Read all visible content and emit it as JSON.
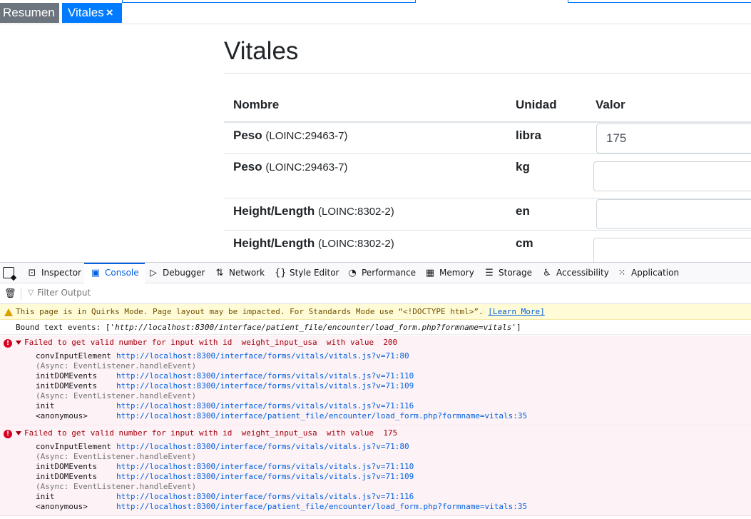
{
  "tabs": [
    {
      "label": "Resumen"
    },
    {
      "label": "Vitales",
      "close": "×"
    }
  ],
  "form": {
    "title": "Vitales",
    "headers": {
      "name": "Nombre",
      "unit": "Unidad",
      "value": "Valor"
    },
    "rows": [
      {
        "name": "Peso",
        "code": "(LOINC:29463-7)",
        "unit": "libra",
        "value": "175"
      },
      {
        "name": "Peso",
        "code": "(LOINC:29463-7)",
        "unit": "kg",
        "value": ""
      },
      {
        "name": "Height/Length",
        "code": "(LOINC:8302-2)",
        "unit": "en",
        "value": ""
      },
      {
        "name": "Height/Length",
        "code": "(LOINC:8302-2)",
        "unit": "cm",
        "value": ""
      }
    ]
  },
  "devtools": {
    "tabs": [
      {
        "label": "Inspector",
        "icon": "inspector-icon"
      },
      {
        "label": "Console",
        "icon": "console-icon",
        "active": true
      },
      {
        "label": "Debugger",
        "icon": "debugger-icon"
      },
      {
        "label": "Network",
        "icon": "network-icon"
      },
      {
        "label": "Style Editor",
        "icon": "style-editor-icon"
      },
      {
        "label": "Performance",
        "icon": "performance-icon"
      },
      {
        "label": "Memory",
        "icon": "memory-icon"
      },
      {
        "label": "Storage",
        "icon": "storage-icon"
      },
      {
        "label": "Accessibility",
        "icon": "accessibility-icon"
      },
      {
        "label": "Application",
        "icon": "application-icon"
      }
    ],
    "filter_placeholder": "Filter Output",
    "colors": {
      "accent": "#0061e0",
      "error": "#a4000f",
      "error_bg": "#fdf2f5",
      "warning_bg": "#fffbd6"
    },
    "warning": {
      "text": "This page is in Quirks Mode. Page layout may be impacted. For Standards Mode use “<!DOCTYPE html>”.",
      "link": "[Learn More]"
    },
    "log": {
      "prefix": "Bound text events: ['",
      "url": "http://localhost:8300/interface/patient_file/encounter/load_form.php?formname=vitals",
      "suffix": "']"
    },
    "errors": [
      {
        "message": "Failed to get valid number for input with id  weight_input_usa  with value  200",
        "frames": [
          {
            "fn": "convInputElement",
            "url": "http://localhost:8300/interface/forms/vitals/vitals.js?v=71:80"
          },
          {
            "async": "(Async: EventListener.handleEvent)"
          },
          {
            "fn": "initDOMEvents",
            "url": "http://localhost:8300/interface/forms/vitals/vitals.js?v=71:110"
          },
          {
            "fn": "initDOMEvents",
            "url": "http://localhost:8300/interface/forms/vitals/vitals.js?v=71:109"
          },
          {
            "async": "(Async: EventListener.handleEvent)"
          },
          {
            "fn": "init",
            "url": "http://localhost:8300/interface/forms/vitals/vitals.js?v=71:116"
          },
          {
            "fn": "<anonymous>",
            "url": "http://localhost:8300/interface/patient_file/encounter/load_form.php?formname=vitals:35"
          }
        ]
      },
      {
        "message": "Failed to get valid number for input with id  weight_input_usa  with value  175",
        "frames": [
          {
            "fn": "convInputElement",
            "url": "http://localhost:8300/interface/forms/vitals/vitals.js?v=71:80"
          },
          {
            "async": "(Async: EventListener.handleEvent)"
          },
          {
            "fn": "initDOMEvents",
            "url": "http://localhost:8300/interface/forms/vitals/vitals.js?v=71:110"
          },
          {
            "fn": "initDOMEvents",
            "url": "http://localhost:8300/interface/forms/vitals/vitals.js?v=71:109"
          },
          {
            "async": "(Async: EventListener.handleEvent)"
          },
          {
            "fn": "init",
            "url": "http://localhost:8300/interface/forms/vitals/vitals.js?v=71:116"
          },
          {
            "fn": "<anonymous>",
            "url": "http://localhost:8300/interface/patient_file/encounter/load_form.php?formname=vitals:35"
          }
        ]
      }
    ]
  }
}
